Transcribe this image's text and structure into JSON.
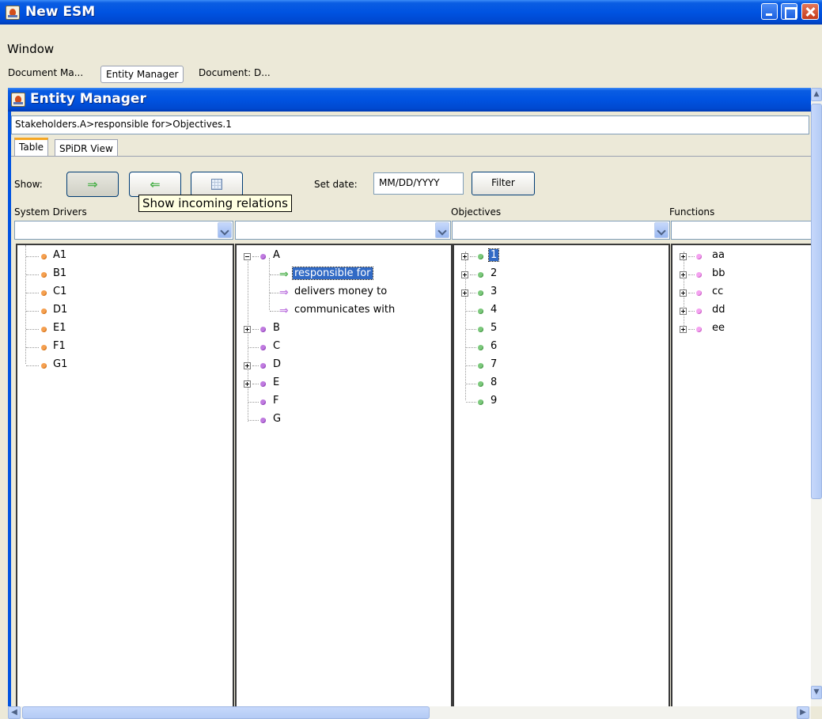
{
  "window": {
    "title": "New ESM"
  },
  "menu": {
    "window_label": "Window"
  },
  "doc_tabs": [
    "Document Ma...",
    "Entity Manager",
    "Document: D..."
  ],
  "internal": {
    "title": "Entity Manager"
  },
  "path": "Stakeholders.A>responsible for>Objectives.1",
  "view_tabs": [
    "Table",
    "SPiDR View"
  ],
  "toolbar": {
    "show_label": "Show:",
    "set_date_label": "Set date:",
    "date_value": "MM/DD/YYYY",
    "filter_label": "Filter",
    "outgoing_icon": "⇒",
    "incoming_icon": "⇐",
    "tooltip": "Show incoming relations"
  },
  "columns": [
    {
      "header": "System Drivers",
      "items": [
        "A1",
        "B1",
        "C1",
        "D1",
        "E1",
        "F1",
        "G1"
      ]
    },
    {
      "header": "",
      "items": [
        "A",
        "responsible for",
        "delivers money to",
        "communicates with",
        "B",
        "C",
        "D",
        "E",
        "F",
        "G"
      ]
    },
    {
      "header": "Objectives",
      "items": [
        "1",
        "2",
        "3",
        "4",
        "5",
        "6",
        "7",
        "8",
        "9"
      ]
    },
    {
      "header": "Functions",
      "items": [
        "aa",
        "bb",
        "cc",
        "dd",
        "ee"
      ]
    }
  ],
  "colors": {
    "xp_blue": "#0053e1",
    "drivers_dot": "#f5a050",
    "stakeholders_dot": "#c07be0",
    "objectives_dot": "#7cc97c",
    "functions_dot": "#f4a3f0",
    "selection": "#316ac5"
  }
}
